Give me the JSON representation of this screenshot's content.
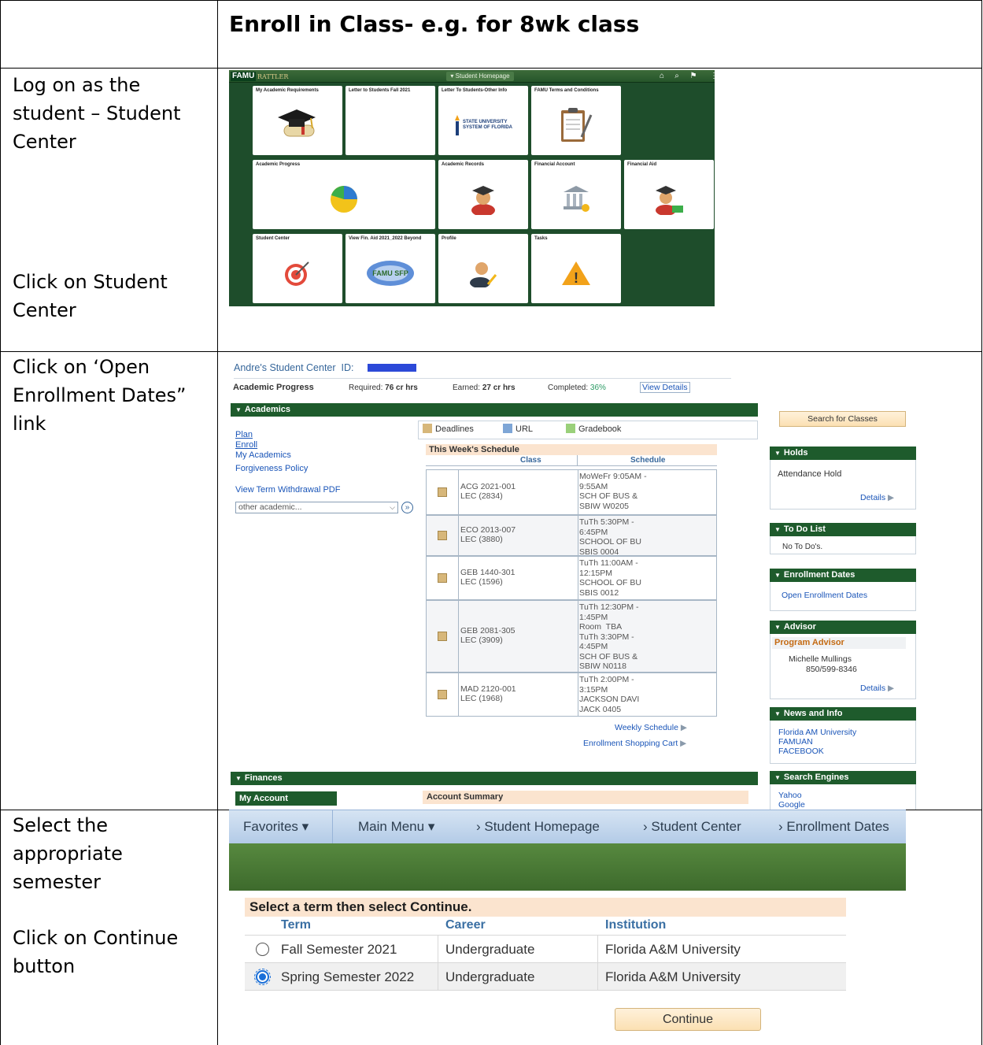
{
  "title": "Enroll in Class- e.g. for 8wk class",
  "steps": {
    "s1a": "Log on as the student – Student Center",
    "s1b": "Click on Student Center",
    "s2": "Click on ‘Open Enrollment Dates” link",
    "s3a": "Select the appropriate semester",
    "s3b": "Click on Continue button"
  },
  "homepage": {
    "logo": "FAMU",
    "logo_sub": "RATTLER",
    "nav_label": "▾ Student Homepage",
    "tiles": [
      {
        "label": "My Academic Requirements",
        "icon": "graduation-cap-diploma-icon"
      },
      {
        "label": "Letter to Students Fall 2021",
        "icon": "blank-icon"
      },
      {
        "label": "Letter To Students-Other Info",
        "icon": "state-university-logo-icon",
        "logo_text_1": "STATE UNIVERSITY",
        "logo_text_2": "SYSTEM OF FLORIDA"
      },
      {
        "label": "FAMU Terms and Conditions",
        "icon": "clipboard-icon"
      },
      {
        "label": "Academic Progress",
        "icon": "pie-chart-icon"
      },
      {
        "label": "Academic Records",
        "icon": "student-avatar-icon"
      },
      {
        "label": "Financial Account",
        "icon": "bank-icon"
      },
      {
        "label": "Financial Aid",
        "icon": "aid-avatar-icon"
      },
      {
        "label": "Student Center",
        "icon": "target-icon"
      },
      {
        "label": "View Fin. Aid 2021_2022 Beyond",
        "icon": "famu-sfp-logo-icon",
        "logo_text": "FAMU SFP"
      },
      {
        "label": "Profile",
        "icon": "profile-icon"
      },
      {
        "label": "Tasks",
        "icon": "warning-icon",
        "glyph": "!"
      }
    ]
  },
  "student_center": {
    "header": "Andre's Student Center",
    "id_label": "ID:",
    "progress": {
      "label": "Academic Progress",
      "required_label": "Required:",
      "required_value": "76 cr hrs",
      "earned_label": "Earned:",
      "earned_value": "27 cr hrs",
      "completed_label": "Completed:",
      "completed_value": "36%",
      "details_link": "View Details"
    },
    "academics": {
      "header": "Academics",
      "links": [
        "Plan",
        "Enroll",
        "My Academics",
        "Forgiveness Policy",
        "View Term Withdrawal PDF"
      ],
      "select_value": "other academic...",
      "tools": [
        "Deadlines",
        "URL",
        "Gradebook"
      ],
      "schedule_title": "This Week's Schedule",
      "col_class": "Class",
      "col_schedule": "Schedule",
      "rows": [
        {
          "cls": "ACG 2021-001\nLEC (2834)",
          "sched": "MoWeFr 9:05AM -\n9:55AM\nSCH OF BUS &\nSBIW W0205"
        },
        {
          "cls": "ECO 2013-007\nLEC (3880)",
          "sched": "TuTh 5:30PM -\n6:45PM\nSCHOOL OF BU\nSBIS 0004"
        },
        {
          "cls": "GEB 1440-301\nLEC (1596)",
          "sched": "TuTh 11:00AM -\n12:15PM\nSCHOOL OF BU\nSBIS 0012"
        },
        {
          "cls": "GEB 2081-305\nLEC (3909)",
          "sched": "TuTh 12:30PM -\n1:45PM\nRoom  TBA\nTuTh 3:30PM -\n4:45PM\nSCH OF BUS &\nSBIW N0118"
        },
        {
          "cls": "MAD 2120-001\nLEC (1968)",
          "sched": "TuTh 2:00PM -\n3:15PM\nJACKSON DAVI\nJACK 0405"
        }
      ],
      "weekly_link": "Weekly Schedule",
      "cart_link": "Enrollment Shopping Cart"
    },
    "finances": {
      "header": "Finances",
      "my_account": "My Account",
      "summary": "Account Summary"
    },
    "sidebar": {
      "search_button": "Search for Classes",
      "holds_header": "Holds",
      "holds_item": "Attendance Hold",
      "details": "Details",
      "todo_header": "To Do List",
      "todo_item": "No To Do's.",
      "enroll_header": "Enrollment Dates",
      "enroll_link": "Open Enrollment Dates",
      "advisor_header": "Advisor",
      "advisor_title": "Program Advisor",
      "advisor_name": "Michelle Mullings",
      "advisor_phone": "850/599-8346",
      "news_header": "News and Info",
      "news_links": [
        "Florida AM University",
        "FAMUAN",
        "FACEBOOK"
      ],
      "search_header": "Search Engines",
      "search_links": [
        "Yahoo",
        "Google"
      ]
    }
  },
  "enrollment_dates": {
    "breadcrumb": [
      "Favorites ▾",
      "Main Menu ▾",
      "›  Student Homepage",
      "›  Student Center",
      "›  Enrollment Dates"
    ],
    "prompt": "Select a term then select Continue.",
    "cols": {
      "term": "Term",
      "career": "Career",
      "institution": "Institution"
    },
    "rows": [
      {
        "term": "Fall Semester 2021",
        "career": "Undergraduate",
        "institution": "Florida A&M University",
        "selected": false
      },
      {
        "term": "Spring Semester 2022",
        "career": "Undergraduate",
        "institution": "Florida A&M University",
        "selected": true
      }
    ],
    "continue": "Continue"
  },
  "colors": {
    "famu_green": "#1e4d2b",
    "link_blue": "#1a55b8",
    "header_green": "#1e5b2c",
    "select_blue": "#1a6fd8"
  }
}
